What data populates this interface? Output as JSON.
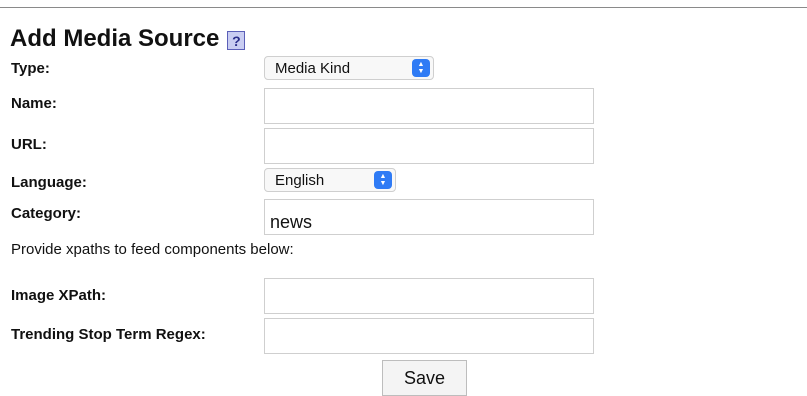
{
  "page": {
    "title": "Add Media Source",
    "help_label": "?"
  },
  "form": {
    "type": {
      "label": "Type:",
      "selected": "Media Kind"
    },
    "name": {
      "label": "Name:",
      "value": ""
    },
    "url": {
      "label": "URL:",
      "value": ""
    },
    "language": {
      "label": "Language:",
      "selected": "English"
    },
    "category": {
      "label": "Category:",
      "value": "news"
    },
    "xpath_note": "Provide xpaths to feed components below:",
    "image_xpath": {
      "label": "Image XPath:",
      "value": ""
    },
    "trending_regex": {
      "label": "Trending Stop Term Regex:",
      "value": ""
    },
    "save_label": "Save"
  },
  "icons": {
    "select_arrows": "chevron-up-down-icon"
  },
  "colors": {
    "select_accent": "#2f7bf5",
    "help_button_bg": "#c9cdf2"
  }
}
